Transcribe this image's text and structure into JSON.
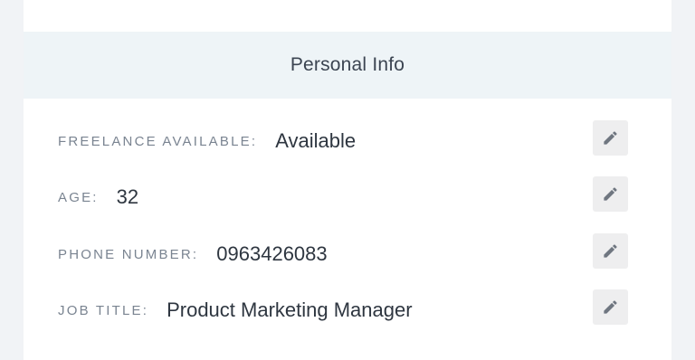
{
  "section": {
    "title": "Personal Info"
  },
  "rows": [
    {
      "label": "FREELANCE AVAILABLE:",
      "value": "Available",
      "action_icon": "pencil-icon"
    },
    {
      "label": "AGE:",
      "value": "32",
      "action_icon": "pencil-icon"
    },
    {
      "label": "PHONE NUMBER:",
      "value": "0963426083",
      "action_icon": "pencil-icon"
    },
    {
      "label": "JOB TITLE:",
      "value": "Product Marketing Manager",
      "action_icon": "pencil-icon"
    }
  ],
  "colors": {
    "page_background": "#f1f3f6",
    "header_background": "#eef4f7",
    "label": "#7a8491",
    "value": "#2e3640",
    "edit_button": "#eeeeef",
    "edit_icon": "#6f7680"
  }
}
